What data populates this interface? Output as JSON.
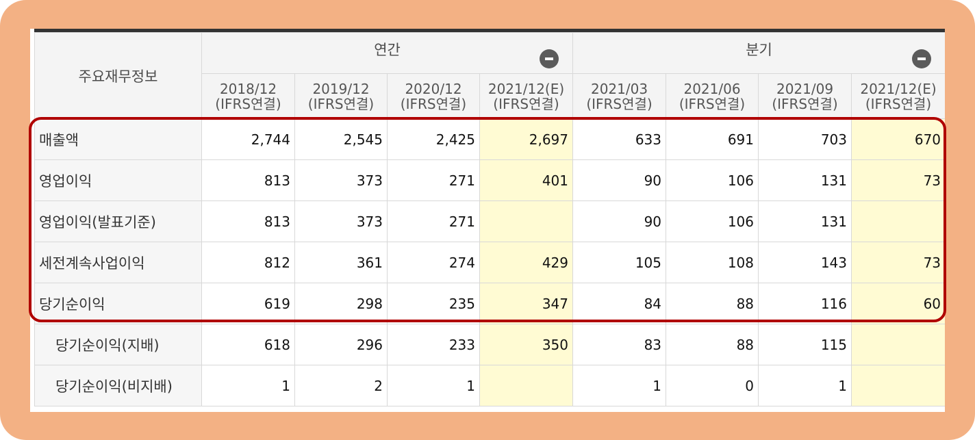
{
  "table": {
    "corner_label": "주요재무정보",
    "groups": [
      {
        "label": "연간",
        "collapse_icon": "minus-circle-icon"
      },
      {
        "label": "분기",
        "collapse_icon": "minus-circle-icon"
      }
    ],
    "periods": [
      {
        "date": "2018/12",
        "basis": "(IFRS연결)"
      },
      {
        "date": "2019/12",
        "basis": "(IFRS연결)"
      },
      {
        "date": "2020/12",
        "basis": "(IFRS연결)"
      },
      {
        "date": "2021/12(E)",
        "basis": "(IFRS연결)"
      },
      {
        "date": "2021/03",
        "basis": "(IFRS연결)"
      },
      {
        "date": "2021/06",
        "basis": "(IFRS연결)"
      },
      {
        "date": "2021/09",
        "basis": "(IFRS연결)"
      },
      {
        "date": "2021/12(E)",
        "basis": "(IFRS연결)"
      }
    ],
    "rows": [
      {
        "label": "매출액",
        "values": [
          "2,744",
          "2,545",
          "2,425",
          "2,697",
          "633",
          "691",
          "703",
          "670"
        ]
      },
      {
        "label": "영업이익",
        "values": [
          "813",
          "373",
          "271",
          "401",
          "90",
          "106",
          "131",
          "73"
        ]
      },
      {
        "label": "영업이익(발표기준)",
        "values": [
          "813",
          "373",
          "271",
          "",
          "90",
          "106",
          "131",
          ""
        ]
      },
      {
        "label": "세전계속사업이익",
        "values": [
          "812",
          "361",
          "274",
          "429",
          "105",
          "108",
          "143",
          "73"
        ]
      },
      {
        "label": "당기순이익",
        "values": [
          "619",
          "298",
          "235",
          "347",
          "84",
          "88",
          "116",
          "60"
        ]
      },
      {
        "label": "당기순이익(지배)",
        "values": [
          "618",
          "296",
          "233",
          "350",
          "83",
          "88",
          "115",
          ""
        ]
      },
      {
        "label": "당기순이익(비지배)",
        "values": [
          "1",
          "2",
          "1",
          "",
          "1",
          "0",
          "1",
          ""
        ]
      }
    ]
  },
  "colors": {
    "frame_background": "#f3b184",
    "estimate_cell": "#fffbd3",
    "highlight_border": "#b00000"
  }
}
